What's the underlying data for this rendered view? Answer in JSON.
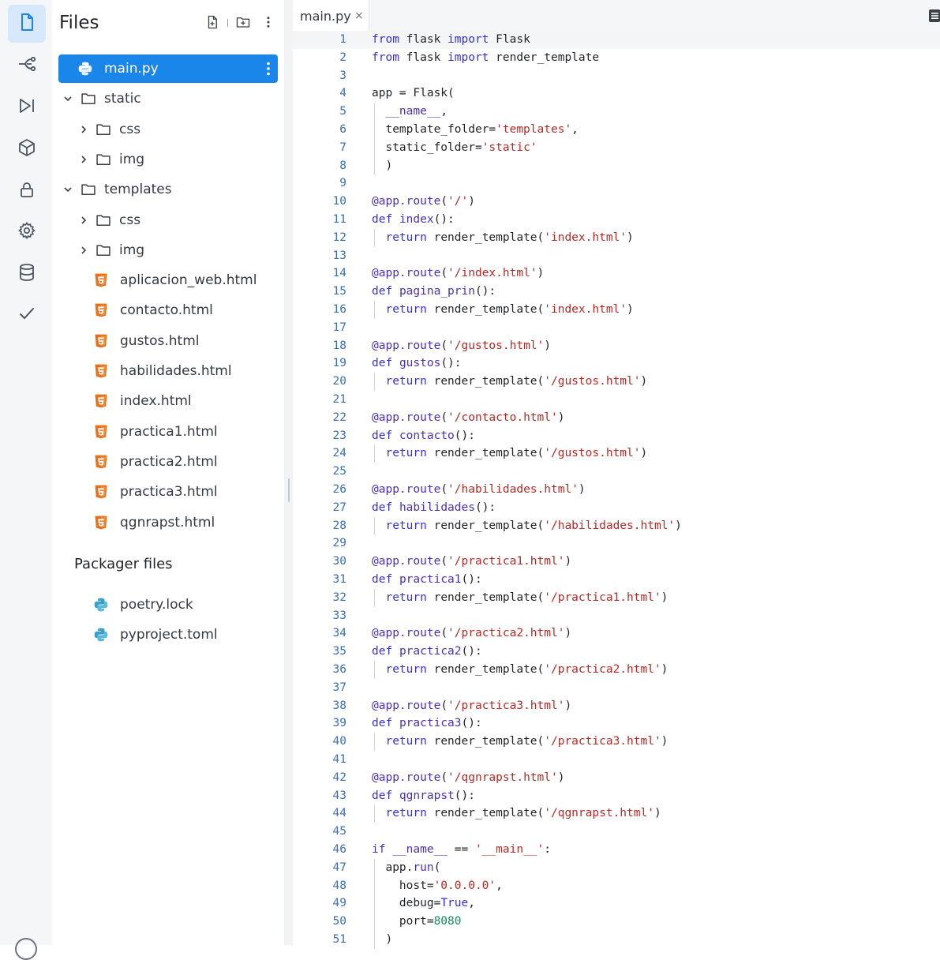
{
  "colors": {
    "accent": "#1b86ea",
    "python_blue": "#3b83c4",
    "python_yellow": "#f2c94c",
    "html_orange": "#e8701a",
    "keyword": "#3431d8",
    "string": "#b62a25",
    "number": "#148a5b",
    "line_number": "#3b6fb6"
  },
  "activity_bar": {
    "items": [
      {
        "icon": "file-icon",
        "active": true
      },
      {
        "icon": "git-branch-icon"
      },
      {
        "icon": "run-icon"
      },
      {
        "icon": "package-icon"
      },
      {
        "icon": "lock-icon"
      },
      {
        "icon": "gear-icon"
      },
      {
        "icon": "database-icon"
      },
      {
        "icon": "check-icon"
      }
    ]
  },
  "files_panel": {
    "title": "Files",
    "actions": [
      "new-file-icon",
      "new-folder-icon",
      "more-vertical-icon"
    ],
    "tree": [
      {
        "label": "main.py",
        "type": "python",
        "depth": 0,
        "selected": true
      },
      {
        "label": "static",
        "type": "folder",
        "depth": 0,
        "expanded": true
      },
      {
        "label": "css",
        "type": "folder",
        "depth": 1,
        "expanded": false
      },
      {
        "label": "img",
        "type": "folder",
        "depth": 1,
        "expanded": false
      },
      {
        "label": "templates",
        "type": "folder",
        "depth": 0,
        "expanded": true
      },
      {
        "label": "css",
        "type": "folder",
        "depth": 1,
        "expanded": false
      },
      {
        "label": "img",
        "type": "folder",
        "depth": 1,
        "expanded": false
      },
      {
        "label": "aplicacion_web.html",
        "type": "html",
        "depth": 1
      },
      {
        "label": "contacto.html",
        "type": "html",
        "depth": 1
      },
      {
        "label": "gustos.html",
        "type": "html",
        "depth": 1
      },
      {
        "label": "habilidades.html",
        "type": "html",
        "depth": 1
      },
      {
        "label": "index.html",
        "type": "html",
        "depth": 1
      },
      {
        "label": "practica1.html",
        "type": "html",
        "depth": 1
      },
      {
        "label": "practica2.html",
        "type": "html",
        "depth": 1
      },
      {
        "label": "practica3.html",
        "type": "html",
        "depth": 1
      },
      {
        "label": "qgnrapst.html",
        "type": "html",
        "depth": 1
      }
    ],
    "packager_title": "Packager files",
    "packager_files": [
      {
        "label": "poetry.lock",
        "type": "python"
      },
      {
        "label": "pyproject.toml",
        "type": "python"
      }
    ]
  },
  "editor": {
    "tab": {
      "label": "main.py",
      "close": "×"
    },
    "lines": [
      [
        [
          "kw",
          "from"
        ],
        [
          "t",
          " flask "
        ],
        [
          "kw",
          "import"
        ],
        [
          "t",
          " Flask"
        ]
      ],
      [
        [
          "kw",
          "from"
        ],
        [
          "t",
          " flask "
        ],
        [
          "kw",
          "import"
        ],
        [
          "t",
          " render_template"
        ]
      ],
      [],
      [
        [
          "t",
          "app = Flask("
        ]
      ],
      [
        [
          "t",
          "  "
        ],
        [
          "fn",
          "__name__"
        ],
        [
          "t",
          ","
        ]
      ],
      [
        [
          "t",
          "  template_folder="
        ],
        [
          "st",
          "'templates'"
        ],
        [
          "t",
          ","
        ]
      ],
      [
        [
          "t",
          "  static_folder="
        ],
        [
          "st",
          "'static'"
        ]
      ],
      [
        [
          "t",
          "  )"
        ]
      ],
      [],
      [
        [
          "fn",
          "@app.route"
        ],
        [
          "t",
          "("
        ],
        [
          "st",
          "'/'"
        ],
        [
          "t",
          ")"
        ]
      ],
      [
        [
          "kw",
          "def"
        ],
        [
          "t",
          " "
        ],
        [
          "fn",
          "index"
        ],
        [
          "t",
          "():"
        ]
      ],
      [
        [
          "t",
          "  "
        ],
        [
          "kw",
          "return"
        ],
        [
          "t",
          " render_template("
        ],
        [
          "st",
          "'index.html'"
        ],
        [
          "t",
          ")"
        ]
      ],
      [],
      [
        [
          "fn",
          "@app.route"
        ],
        [
          "t",
          "("
        ],
        [
          "st",
          "'/index.html'"
        ],
        [
          "t",
          ")"
        ]
      ],
      [
        [
          "kw",
          "def"
        ],
        [
          "t",
          " "
        ],
        [
          "fn",
          "pagina_prin"
        ],
        [
          "t",
          "():"
        ]
      ],
      [
        [
          "t",
          "  "
        ],
        [
          "kw",
          "return"
        ],
        [
          "t",
          " render_template("
        ],
        [
          "st",
          "'index.html'"
        ],
        [
          "t",
          ")"
        ]
      ],
      [],
      [
        [
          "fn",
          "@app.route"
        ],
        [
          "t",
          "("
        ],
        [
          "st",
          "'/gustos.html'"
        ],
        [
          "t",
          ")"
        ]
      ],
      [
        [
          "kw",
          "def"
        ],
        [
          "t",
          " "
        ],
        [
          "fn",
          "gustos"
        ],
        [
          "t",
          "():"
        ]
      ],
      [
        [
          "t",
          "  "
        ],
        [
          "kw",
          "return"
        ],
        [
          "t",
          " render_template("
        ],
        [
          "st",
          "'/gustos.html'"
        ],
        [
          "t",
          ")"
        ]
      ],
      [],
      [
        [
          "fn",
          "@app.route"
        ],
        [
          "t",
          "("
        ],
        [
          "st",
          "'/contacto.html'"
        ],
        [
          "t",
          ")"
        ]
      ],
      [
        [
          "kw",
          "def"
        ],
        [
          "t",
          " "
        ],
        [
          "fn",
          "contacto"
        ],
        [
          "t",
          "():"
        ]
      ],
      [
        [
          "t",
          "  "
        ],
        [
          "kw",
          "return"
        ],
        [
          "t",
          " render_template("
        ],
        [
          "st",
          "'/gustos.html'"
        ],
        [
          "t",
          ")"
        ]
      ],
      [],
      [
        [
          "fn",
          "@app.route"
        ],
        [
          "t",
          "("
        ],
        [
          "st",
          "'/habilidades.html'"
        ],
        [
          "t",
          ")"
        ]
      ],
      [
        [
          "kw",
          "def"
        ],
        [
          "t",
          " "
        ],
        [
          "fn",
          "habilidades"
        ],
        [
          "t",
          "():"
        ]
      ],
      [
        [
          "t",
          "  "
        ],
        [
          "kw",
          "return"
        ],
        [
          "t",
          " render_template("
        ],
        [
          "st",
          "'/habilidades.html'"
        ],
        [
          "t",
          ")"
        ]
      ],
      [],
      [
        [
          "fn",
          "@app.route"
        ],
        [
          "t",
          "("
        ],
        [
          "st",
          "'/practica1.html'"
        ],
        [
          "t",
          ")"
        ]
      ],
      [
        [
          "kw",
          "def"
        ],
        [
          "t",
          " "
        ],
        [
          "fn",
          "practica1"
        ],
        [
          "t",
          "():"
        ]
      ],
      [
        [
          "t",
          "  "
        ],
        [
          "kw",
          "return"
        ],
        [
          "t",
          " render_template("
        ],
        [
          "st",
          "'/practica1.html'"
        ],
        [
          "t",
          ")"
        ]
      ],
      [],
      [
        [
          "fn",
          "@app.route"
        ],
        [
          "t",
          "("
        ],
        [
          "st",
          "'/practica2.html'"
        ],
        [
          "t",
          ")"
        ]
      ],
      [
        [
          "kw",
          "def"
        ],
        [
          "t",
          " "
        ],
        [
          "fn",
          "practica2"
        ],
        [
          "t",
          "():"
        ]
      ],
      [
        [
          "t",
          "  "
        ],
        [
          "kw",
          "return"
        ],
        [
          "t",
          " render_template("
        ],
        [
          "st",
          "'/practica2.html'"
        ],
        [
          "t",
          ")"
        ]
      ],
      [],
      [
        [
          "fn",
          "@app.route"
        ],
        [
          "t",
          "("
        ],
        [
          "st",
          "'/practica3.html'"
        ],
        [
          "t",
          ")"
        ]
      ],
      [
        [
          "kw",
          "def"
        ],
        [
          "t",
          " "
        ],
        [
          "fn",
          "practica3"
        ],
        [
          "t",
          "():"
        ]
      ],
      [
        [
          "t",
          "  "
        ],
        [
          "kw",
          "return"
        ],
        [
          "t",
          " render_template("
        ],
        [
          "st",
          "'/practica3.html'"
        ],
        [
          "t",
          ")"
        ]
      ],
      [],
      [
        [
          "fn",
          "@app.route"
        ],
        [
          "t",
          "("
        ],
        [
          "st",
          "'/qgnrapst.html'"
        ],
        [
          "t",
          ")"
        ]
      ],
      [
        [
          "kw",
          "def"
        ],
        [
          "t",
          " "
        ],
        [
          "fn",
          "qgnrapst"
        ],
        [
          "t",
          "():"
        ]
      ],
      [
        [
          "t",
          "  "
        ],
        [
          "kw",
          "return"
        ],
        [
          "t",
          " render_template("
        ],
        [
          "st",
          "'/qgnrapst.html'"
        ],
        [
          "t",
          ")"
        ]
      ],
      [],
      [
        [
          "kw",
          "if"
        ],
        [
          "t",
          " "
        ],
        [
          "fn",
          "__name__"
        ],
        [
          "t",
          " == "
        ],
        [
          "st",
          "'__main__'"
        ],
        [
          "t",
          ":"
        ]
      ],
      [
        [
          "t",
          "  app."
        ],
        [
          "fn",
          "run"
        ],
        [
          "t",
          "("
        ]
      ],
      [
        [
          "t",
          "    host="
        ],
        [
          "st",
          "'0.0.0.0'"
        ],
        [
          "t",
          ","
        ]
      ],
      [
        [
          "t",
          "    debug="
        ],
        [
          "kw",
          "True"
        ],
        [
          "t",
          ","
        ]
      ],
      [
        [
          "t",
          "    port="
        ],
        [
          "num",
          "8080"
        ]
      ],
      [
        [
          "t",
          "  )"
        ]
      ]
    ]
  }
}
